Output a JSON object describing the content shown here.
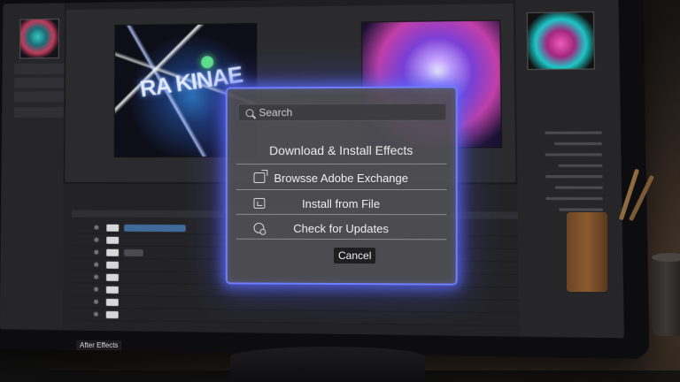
{
  "dialog": {
    "search_placeholder": "Search",
    "title": "Download & Install Effects",
    "items": [
      {
        "label": "Browsse Adobe Exchange",
        "icon": "external-link-icon"
      },
      {
        "label": "Install from File",
        "icon": "import-file-icon"
      },
      {
        "label": "Check for Updates",
        "icon": "update-check-icon"
      }
    ],
    "cancel_label": "Cancel",
    "glow_color": "#6f7dff"
  },
  "app": {
    "taskbar_label": "After Effects",
    "viewer_text": "RA KINAE"
  }
}
